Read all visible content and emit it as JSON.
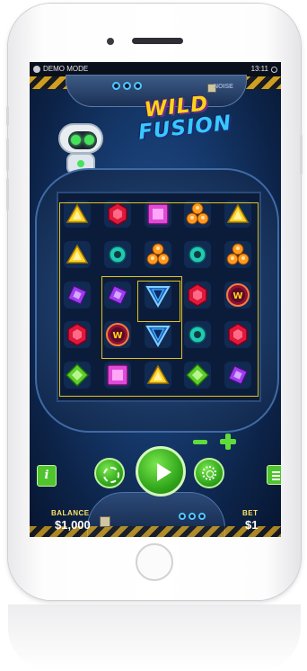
{
  "status_bar": {
    "mode_label": "DEMO MODE",
    "time": "13:11"
  },
  "header": {
    "noise_tag": "NOISE"
  },
  "logo": {
    "line1": "WILD",
    "line2": "FUSION"
  },
  "board": {
    "rows": [
      [
        "yellow-triangle",
        "red-gem",
        "pink-square",
        "orange-cluster",
        "yellow-triangle"
      ],
      [
        "yellow-triangle",
        "teal-circle",
        "orange-cluster",
        "teal-circle",
        "orange-cluster"
      ],
      [
        "purple-diamond",
        "purple-diamond",
        "blue-triangle",
        "red-gem",
        "wild-coin"
      ],
      [
        "red-gem",
        "wild-coin",
        "blue-triangle",
        "teal-circle",
        "red-gem"
      ],
      [
        "green-square",
        "pink-square",
        "yellow-triangle",
        "green-square",
        "purple-diamond"
      ]
    ]
  },
  "controls": {
    "info_label": "i",
    "minus_label": "−",
    "plus_label": "+"
  },
  "footer": {
    "balance_label": "BALANCE",
    "balance_value": "$1,000",
    "bet_label": "BET",
    "bet_value": "$1"
  },
  "colors": {
    "accent_green": "#4fc42e",
    "label_yellow": "#ffe266",
    "highlight_gold": "#e2c21a"
  }
}
